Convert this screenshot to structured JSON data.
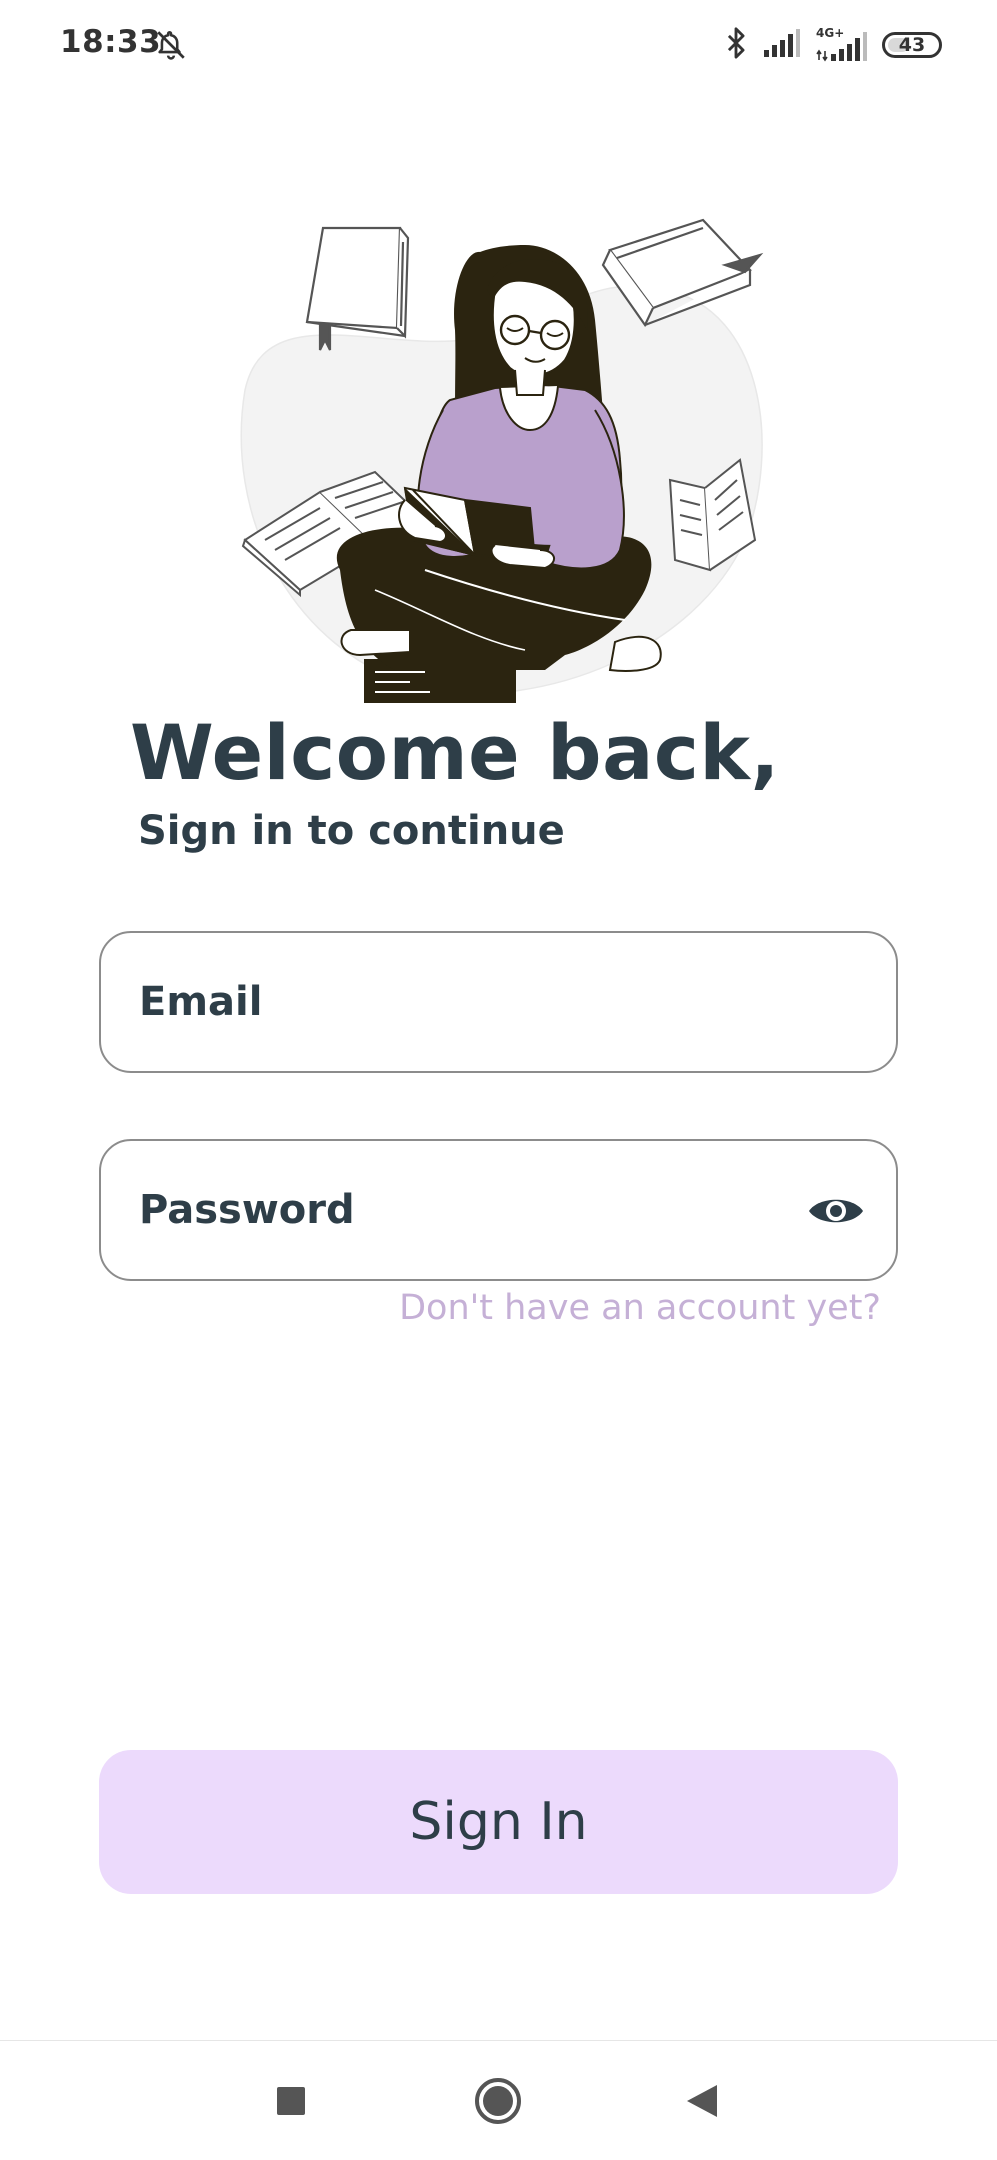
{
  "status_bar": {
    "time": "18:33",
    "network_label": "4G+",
    "battery": "43",
    "battery_level_percent": 43
  },
  "login": {
    "title": "Welcome back,",
    "subtitle": "Sign in to continue",
    "email_placeholder": "Email",
    "password_placeholder": "Password",
    "signup_link": "Don't have an account yet?",
    "signin_label": "Sign In"
  },
  "icons": {
    "mute": "bell-off-icon",
    "bluetooth": "bluetooth-icon",
    "signal": "signal-icon",
    "battery": "battery-icon",
    "password_toggle": "eye-icon",
    "nav_recent": "square-icon",
    "nav_home": "circle-icon",
    "nav_back": "triangle-back-icon"
  },
  "colors": {
    "title_text": "#2e3e48",
    "link_text": "#c5b0d6",
    "button_background": "#ecdafc",
    "illustration_accent": "#b9a0cc",
    "field_border": "#8c8c8c"
  }
}
